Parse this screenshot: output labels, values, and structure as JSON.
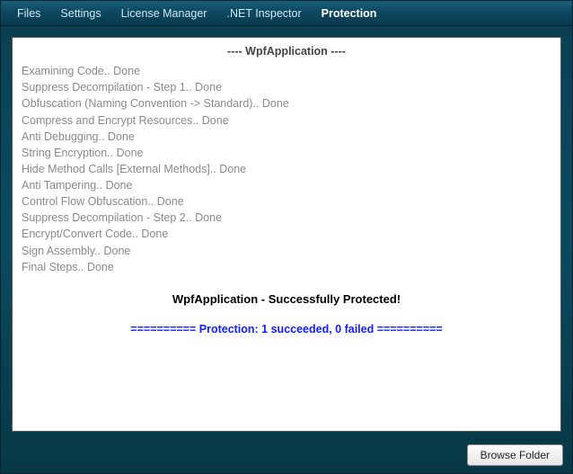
{
  "menu": {
    "items": [
      {
        "label": "Files"
      },
      {
        "label": "Settings"
      },
      {
        "label": "License Manager"
      },
      {
        "label": ".NET Inspector"
      },
      {
        "label": "Protection"
      }
    ],
    "activeIndex": 4
  },
  "log": {
    "header": "---- WpfApplication ----",
    "lines": [
      "Examining Code.. Done",
      "Suppress Decompilation - Step 1.. Done",
      "Obfuscation (Naming Convention -> Standard).. Done",
      "Compress and Encrypt Resources.. Done",
      "Anti Debugging.. Done",
      "String Encryption.. Done",
      "Hide Method Calls [External Methods].. Done",
      "Anti Tampering.. Done",
      "Control Flow Obfuscation.. Done",
      "Suppress Decompilation - Step 2.. Done",
      "Encrypt/Convert Code.. Done",
      "Sign Assembly.. Done",
      "Final Steps.. Done"
    ],
    "success": "WpfApplication - Successfully Protected!",
    "summary": "========== Protection: 1 succeeded, 0 failed =========="
  },
  "footer": {
    "browse_label": "Browse Folder"
  }
}
